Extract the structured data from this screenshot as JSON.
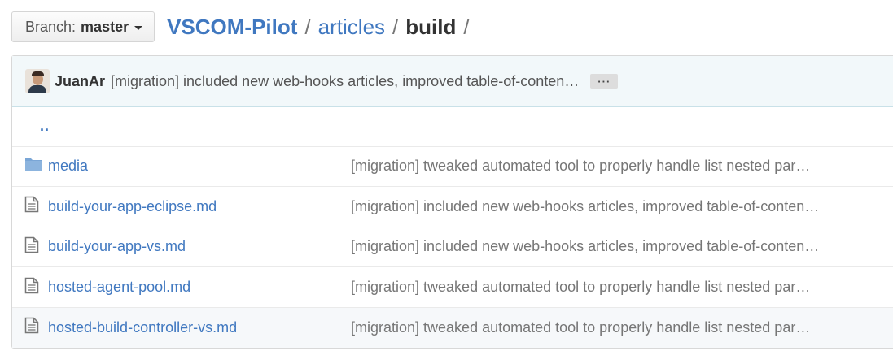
{
  "branch": {
    "label": "Branch:",
    "value": "master"
  },
  "breadcrumb": {
    "root": "VSCOM-Pilot",
    "separator": "/",
    "items": [
      "articles"
    ],
    "current": "build"
  },
  "commit": {
    "author": "JuanAr",
    "message": "[migration] included new web-hooks articles, improved table-of-conten…",
    "more_label": "···"
  },
  "parent_link": "..",
  "files": [
    {
      "type": "folder",
      "icon": "folder-icon",
      "name": "media",
      "message": "[migration] tweaked automated tool to properly handle list nested par…"
    },
    {
      "type": "file",
      "icon": "file-text-icon",
      "name": "build-your-app-eclipse.md",
      "message": "[migration] included new web-hooks articles, improved table-of-conten…"
    },
    {
      "type": "file",
      "icon": "file-text-icon",
      "name": "build-your-app-vs.md",
      "message": "[migration] included new web-hooks articles, improved table-of-conten…"
    },
    {
      "type": "file",
      "icon": "file-text-icon",
      "name": "hosted-agent-pool.md",
      "message": "[migration] tweaked automated tool to properly handle list nested par…"
    },
    {
      "type": "file",
      "icon": "file-text-icon",
      "name": "hosted-build-controller-vs.md",
      "message": "[migration] tweaked automated tool to properly handle list nested par…"
    }
  ],
  "colors": {
    "link": "#4078c0",
    "commit_bg": "#f2f8fa",
    "muted": "#767676"
  }
}
